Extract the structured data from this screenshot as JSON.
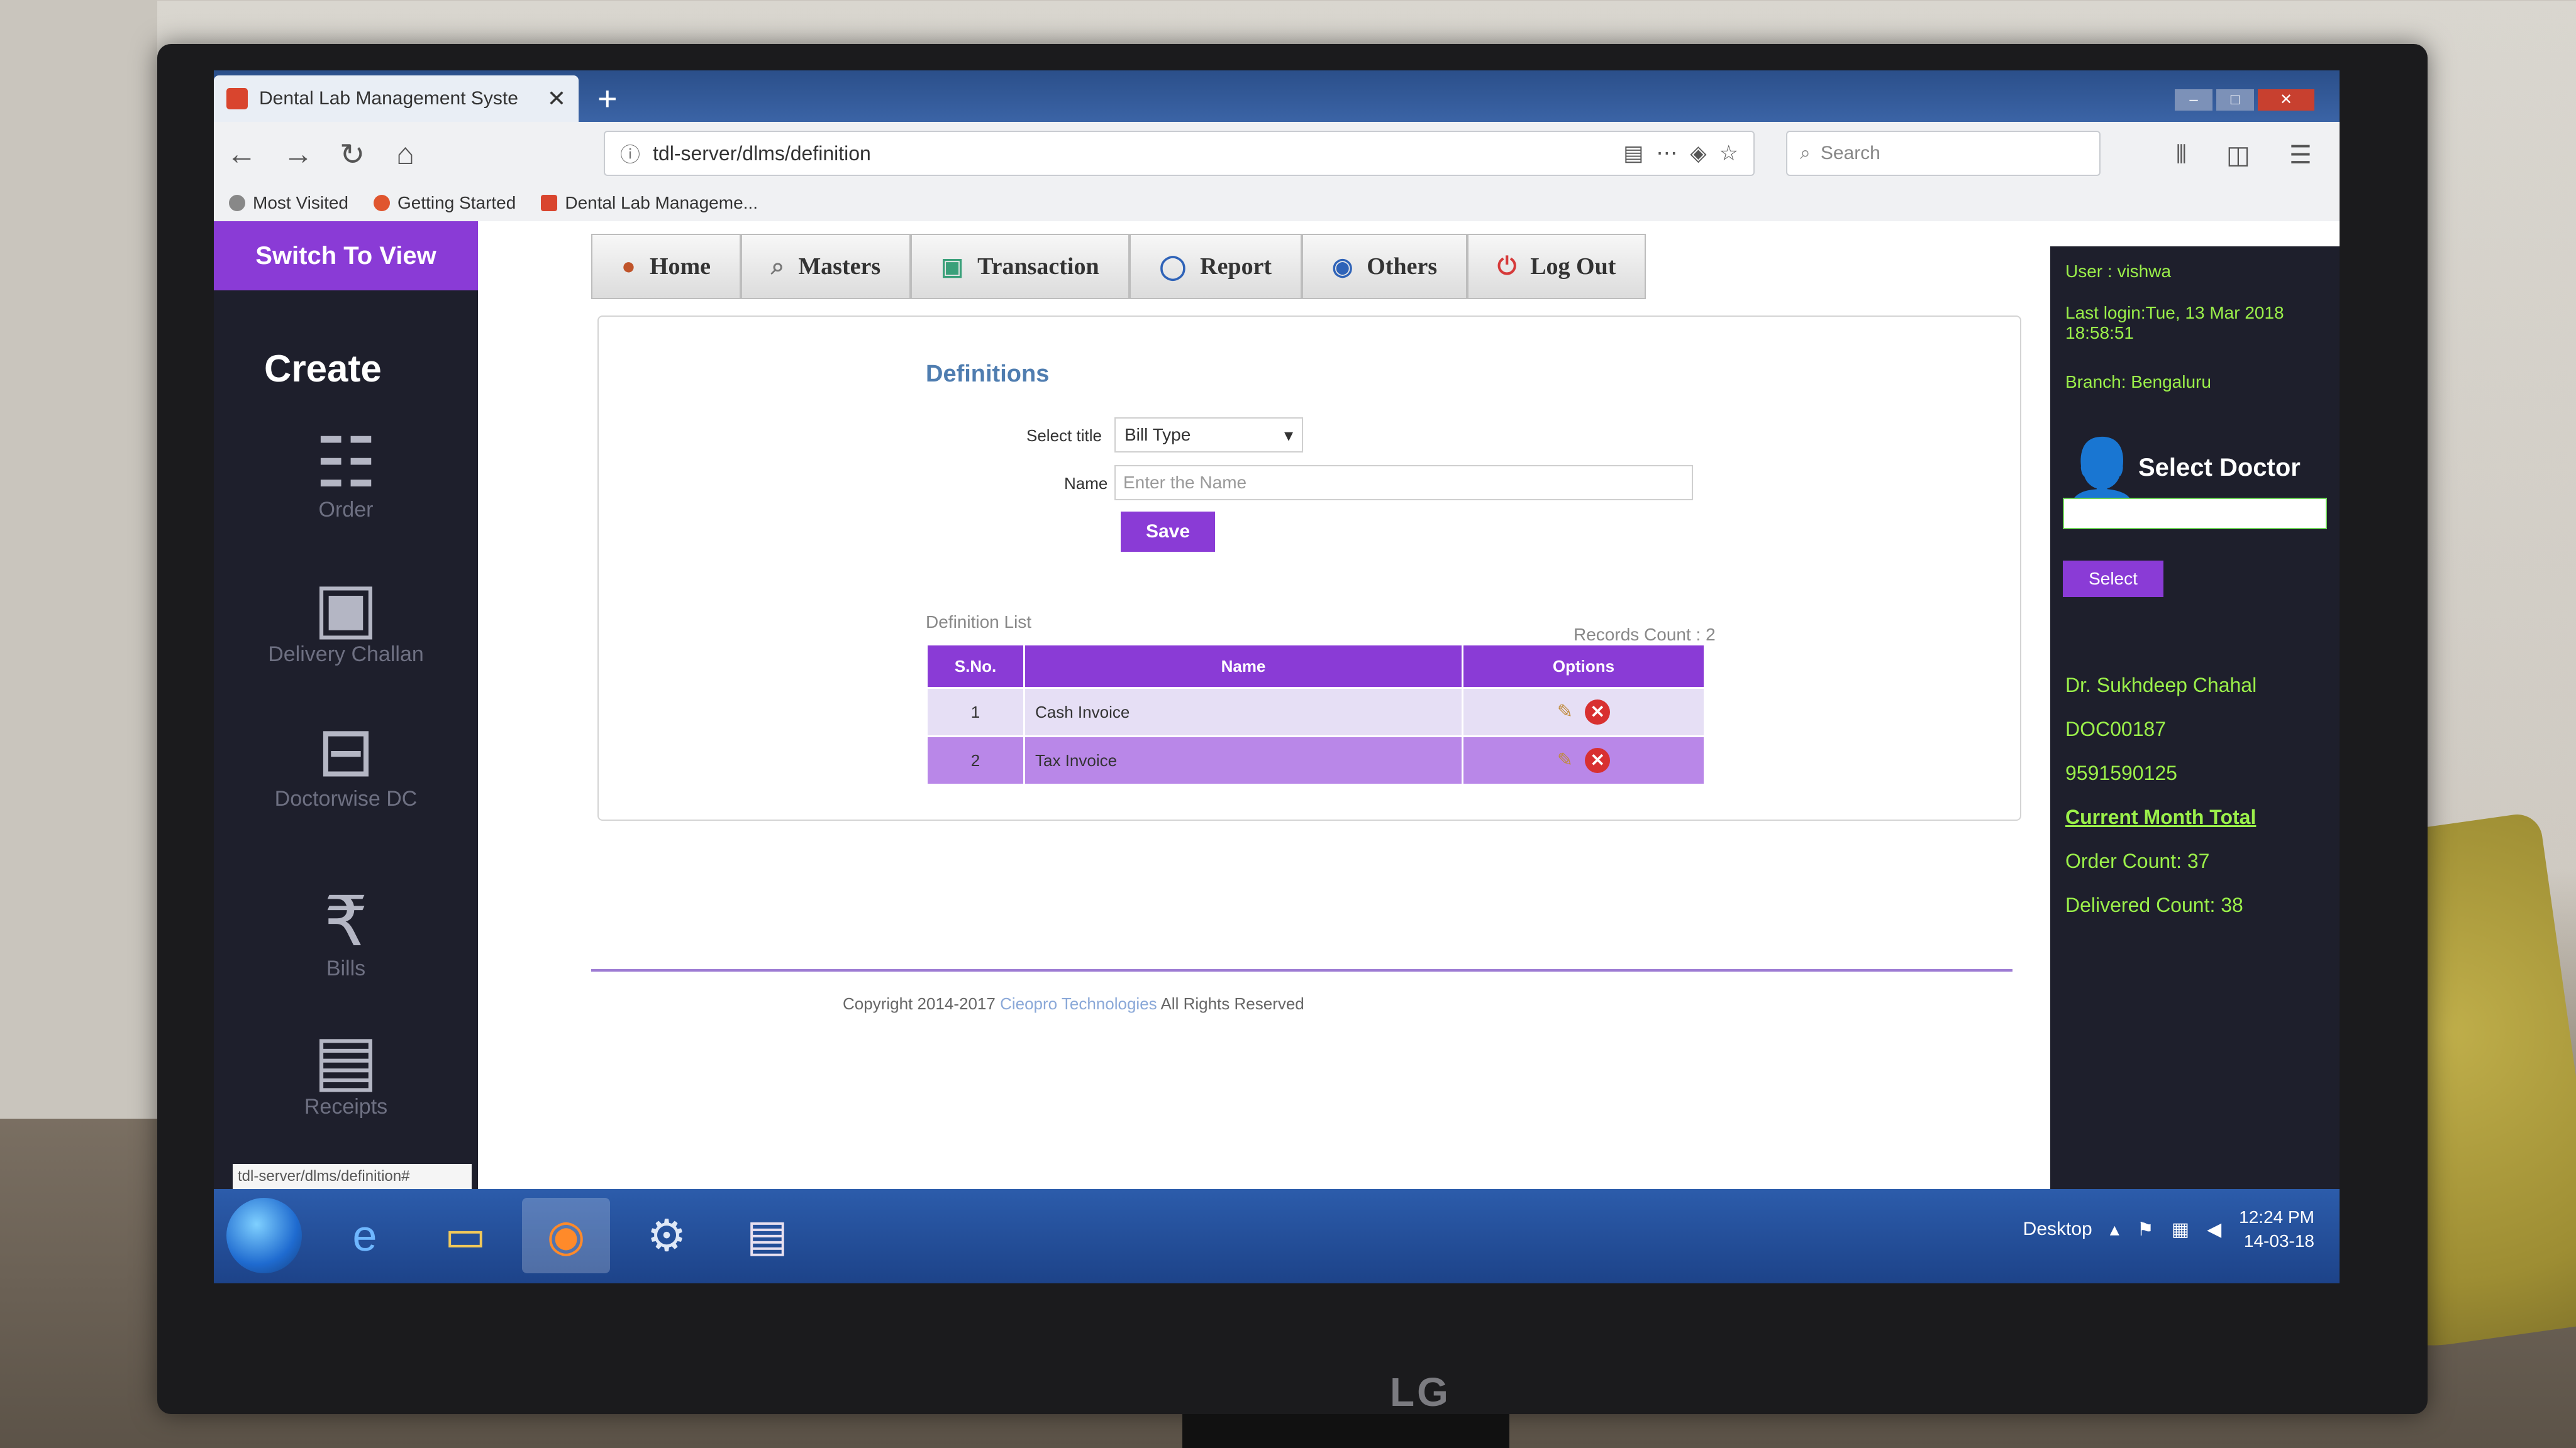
{
  "browser": {
    "tab_title": "Dental Lab Management Syste",
    "tab_close": "✕",
    "new_tab": "+",
    "url": "tdl-server/dlms/definition",
    "search_placeholder": "Search",
    "bookmarks": [
      "Most Visited",
      "Getting Started",
      "Dental Lab Manageme..."
    ]
  },
  "app": {
    "switch_view": "Switch To View",
    "left_nav": {
      "heading": "Create",
      "items": [
        {
          "label": "Order",
          "icon": "order-list-icon"
        },
        {
          "label": "Delivery Challan",
          "icon": "delivery-challan-icon"
        },
        {
          "label": "Doctorwise DC",
          "icon": "doctorwise-dc-icon"
        },
        {
          "label": "Bills",
          "icon": "rupee-bills-icon"
        },
        {
          "label": "Receipts",
          "icon": "receipts-icon"
        }
      ]
    },
    "menu": [
      {
        "label": "Home",
        "icon": "home-icon"
      },
      {
        "label": "Masters",
        "icon": "search-icon"
      },
      {
        "label": "Transaction",
        "icon": "transaction-icon"
      },
      {
        "label": "Report",
        "icon": "report-icon"
      },
      {
        "label": "Others",
        "icon": "others-icon"
      },
      {
        "label": "Log Out",
        "icon": "logout-icon"
      }
    ],
    "definitions": {
      "title": "Definitions",
      "select_title_label": "Select title",
      "select_title_value": "Bill Type",
      "name_label": "Name",
      "name_placeholder": "Enter the Name",
      "save_label": "Save"
    },
    "list": {
      "heading": "Definition List",
      "records_count": "Records Count : 2",
      "columns": [
        "S.No.",
        "Name",
        "Options"
      ],
      "rows": [
        {
          "sno": "1",
          "name": "Cash Invoice"
        },
        {
          "sno": "2",
          "name": "Tax Invoice"
        }
      ]
    },
    "footer": {
      "copyright_prefix": "Copyright 2014-2017",
      "company": "Cieopro Technologies",
      "suffix": "All Rights Reserved"
    },
    "right_panel": {
      "user": "User : vishwa",
      "last_login": "Last login:Tue, 13 Mar 2018 18:58:51",
      "branch": "Branch: Bengaluru",
      "select_doctor": "Select Doctor",
      "select_button": "Select",
      "doctor_name": "Dr. Sukhdeep Chahal",
      "doctor_code": "DOC00187",
      "doctor_phone": "9591590125",
      "month_total_heading": "Current Month Total",
      "order_count": "Order Count: 37",
      "delivered_count": "Delivered Count: 38"
    },
    "status_url": "tdl-server/dlms/definition#"
  },
  "taskbar": {
    "desktop_label": "Desktop",
    "time": "12:24 PM",
    "date": "14-03-18"
  },
  "monitor_brand": "LG",
  "colors": {
    "accent": "#8a3bd6",
    "sidebar": "#1e1f2c",
    "info_text": "#9bf04a"
  }
}
